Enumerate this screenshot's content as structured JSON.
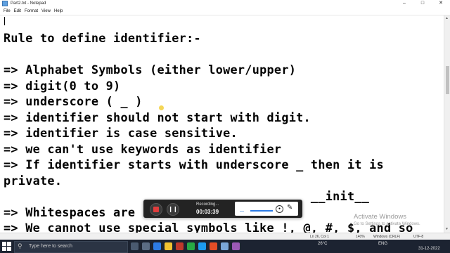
{
  "window": {
    "title": "Part2.txt - Notepad"
  },
  "menu": [
    "File",
    "Edit",
    "Format",
    "View",
    "Help"
  ],
  "lines": [
    "",
    "Rule to define identifier:-",
    "",
    "=> Alphabet Symbols (either lower/upper)",
    "=> digit(0 to 9)",
    "=> underscore ( _ )",
    "=> identifier should not start with digit.",
    "=> identifier is case sensitive.",
    "=> we can't use keywords as identifier",
    "=> If identifier starts with underscore _ then it is",
    "private.",
    "                                          __init__",
    "=> Whitespaces are",
    "=> We cannot use special symbols like !, @, #, $, and so"
  ],
  "status": {
    "position": "Ln 26, Col 1",
    "zoom": "140%",
    "eol": "Windows (CRLF)",
    "encoding": "UTF-8"
  },
  "watermark": {
    "title": "Activate Windows",
    "subtitle": "Go to Settings to activate Windows."
  },
  "recorder": {
    "label": "Recording...",
    "time": "00:03:39"
  },
  "taskbar": {
    "search_placeholder": "Type here to search",
    "weather": "26°C",
    "language": "ENG",
    "time": "",
    "date": "31-12-2022"
  }
}
